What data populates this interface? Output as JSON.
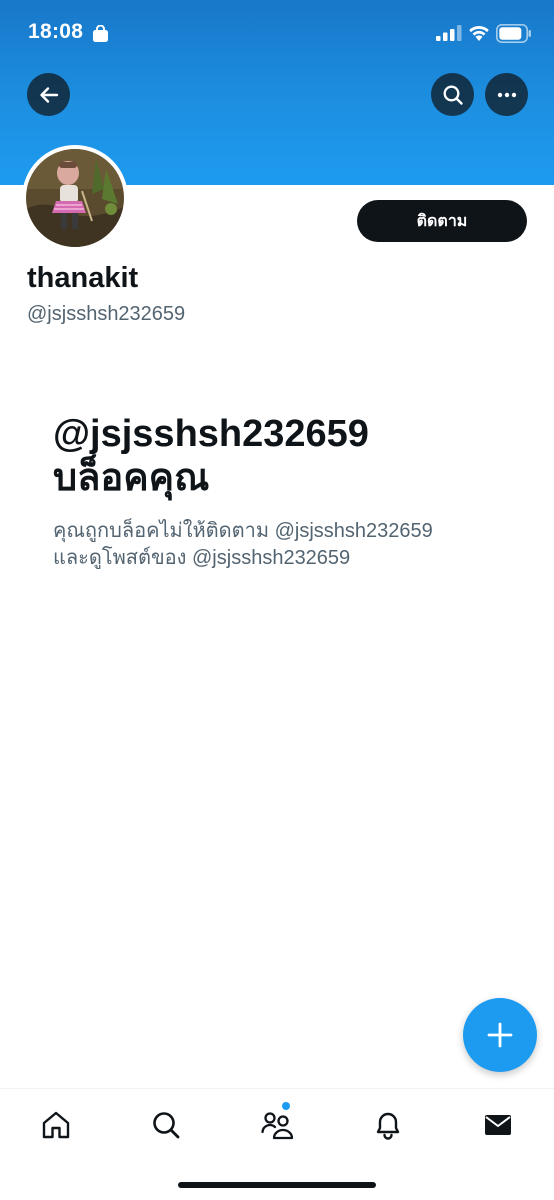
{
  "status_bar": {
    "time": "18:08",
    "icons": [
      "lock-icon",
      "signal-icon",
      "wifi-icon",
      "battery-icon"
    ]
  },
  "header": {
    "back_icon": "arrow-left-icon",
    "search_icon": "search-icon",
    "more_icon": "more-horizontal-icon",
    "banner_color": "#1d9bf0"
  },
  "profile": {
    "display_name": "thanakit",
    "handle": "@jsjsshsh232659",
    "follow_label": "ติดตาม"
  },
  "blocked": {
    "title_line1": "@jsjsshsh232659",
    "title_line2": "บล็อคคุณ",
    "desc_line1": "คุณถูกบล็อคไม่ให้ติดตาม @jsjsshsh232659",
    "desc_line2": "และดูโพสต์ของ @jsjsshsh232659"
  },
  "fab": {
    "icon": "plus-icon",
    "color": "#1d9bf0"
  },
  "tab_bar": {
    "items": [
      {
        "icon": "home-icon"
      },
      {
        "icon": "search-icon"
      },
      {
        "icon": "communities-icon",
        "has_notification_dot": true
      },
      {
        "icon": "bell-icon"
      },
      {
        "icon": "envelope-icon"
      }
    ]
  },
  "colors": {
    "text_primary": "#0f1419",
    "text_secondary": "#536471",
    "accent": "#1d9bf0"
  }
}
